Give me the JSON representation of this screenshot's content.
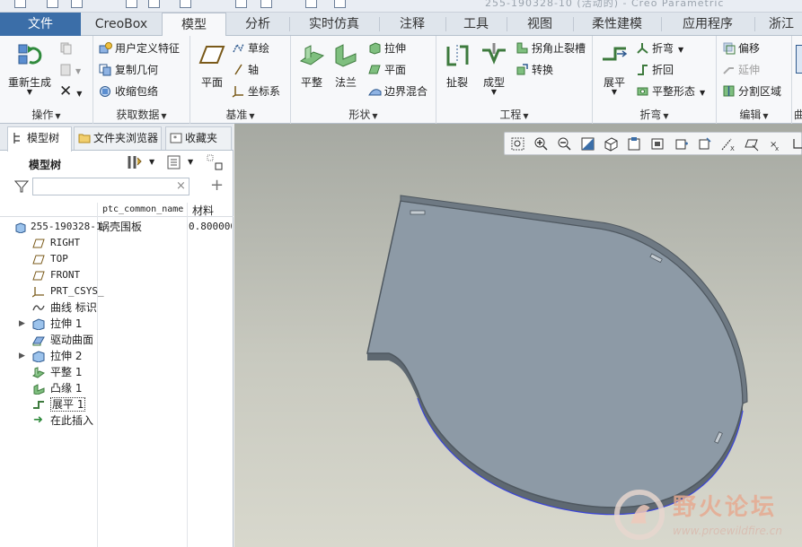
{
  "titlebar": {
    "title": "255-190328-10 (活动的) - Creo Parametric"
  },
  "tabs": [
    "文件",
    "CreoBox",
    "模型",
    "分析",
    "实时仿真",
    "注释",
    "工具",
    "视图",
    "柔性建模",
    "应用程序",
    "浙江"
  ],
  "ribbon": {
    "operations": {
      "label": "操作",
      "regenerate": "重新生成"
    },
    "get_data": {
      "label": "获取数据",
      "udf": "用户定义特征",
      "copy_geom": "复制几何",
      "shrinkwrap": "收缩包络"
    },
    "datum": {
      "label": "基准",
      "plane": "平面",
      "sketch": "草绘",
      "axis": "轴",
      "csys": "坐标系"
    },
    "shapes": {
      "label": "形状",
      "flat": "平整",
      "flange": "法兰",
      "extrude": "拉伸",
      "planar": "平面",
      "blend": "边界混合"
    },
    "engineering": {
      "label": "工程",
      "rip": "扯裂",
      "form": "成型",
      "corner_relief": "拐角止裂槽",
      "convert": "转换"
    },
    "bend": {
      "label": "折弯",
      "unbend": "展平",
      "bend": "折弯",
      "bend_back": "折回",
      "flatten_form": "平整形态"
    },
    "editing": {
      "label": "编辑",
      "offset": "偏移",
      "extend": "延伸",
      "split_area": "分割区域"
    },
    "next_group_label": "曲"
  },
  "panel": {
    "tabs": [
      "模型树",
      "文件夹浏览器",
      "收藏夹"
    ],
    "tree_title": "模型树",
    "filter_placeholder": "",
    "columns": {
      "name_col": "ptc_common_name",
      "material_col": "材料"
    },
    "root": {
      "name": "255-190328-1",
      "common_name": "蜗壳围板",
      "material": "0.800000"
    },
    "items": [
      "RIGHT",
      "TOP",
      "FRONT",
      "PRT_CSYS_",
      "曲线 标识",
      "拉伸 1",
      "驱动曲面",
      "拉伸 2",
      "平整 1",
      "凸缘 1",
      "展平 1",
      "在此插入"
    ]
  },
  "watermark": {
    "text": "野火论坛",
    "url": "www.proewildfire.cn"
  },
  "colors": {
    "accent": "#3b6ea8",
    "part": "#8d9aa6",
    "part_edge": "#5e6871"
  }
}
